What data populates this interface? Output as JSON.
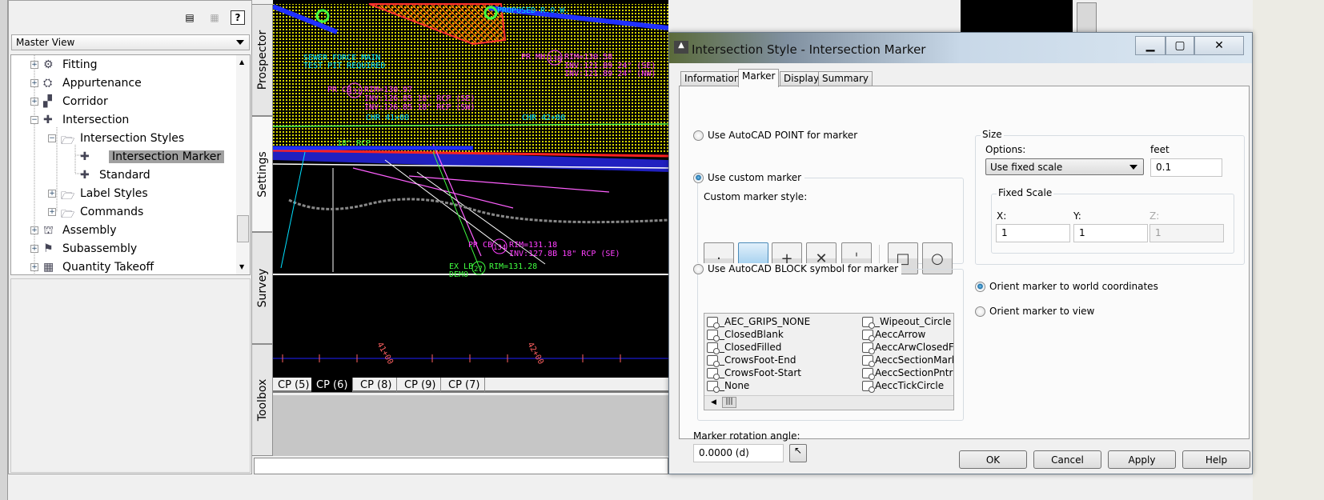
{
  "panel": {
    "toolbar_icons": [
      "item-view-icon",
      "panel-view-icon",
      "help-icon"
    ],
    "help_label": "?",
    "view_select": "Master View",
    "tree": [
      {
        "label": "Fitting",
        "expand": "+"
      },
      {
        "label": "Appurtenance",
        "expand": "+"
      },
      {
        "label": "Corridor",
        "expand": "+"
      },
      {
        "label": "Intersection",
        "expand": "−"
      },
      {
        "label": "Intersection Styles",
        "expand": "−"
      },
      {
        "label": "Intersection Marker",
        "selected": true
      },
      {
        "label": "Standard"
      },
      {
        "label": "Label Styles",
        "expand": "+"
      },
      {
        "label": "Commands",
        "expand": "+"
      },
      {
        "label": "Assembly",
        "expand": "+"
      },
      {
        "label": "Subassembly",
        "expand": "+"
      },
      {
        "label": "Quantity Takeoff",
        "expand": "+"
      }
    ]
  },
  "side_tabs": [
    "Prospector",
    "Settings",
    "Survey",
    "Toolbox"
  ],
  "cad": {
    "labels": [
      "SEWER FORCE MAIN",
      "TEST PIT REQUIRED",
      "PROPOSED R.O.W.",
      "PR MH",
      "138",
      "RIM=130.58",
      "INV:121.89 24\" (SE)",
      "INV:121.89 24\" (NW)",
      "PR CB",
      "131",
      "RIM=130.97",
      "INV:126.85 18\" RCP (SE)",
      "INV:126.85 18\" RCP (SW)",
      "CHR 41+00",
      "CHR 42+00",
      "18\" RCP",
      "PR CB",
      "134",
      "RIM=131.18",
      "INV:127.8B 18\" RCP (SE)",
      "EX LB",
      "27",
      "RIM=131.28",
      "DEMO",
      "41+00",
      "42+00"
    ],
    "layout_tabs": [
      "CP (5)",
      "CP (6)",
      "CP (8)",
      "CP (9)",
      "CP (7)"
    ],
    "active_layout": "CP (6)"
  },
  "dialog": {
    "title": "Intersection Style - Intersection Marker",
    "tabs": [
      "Information",
      "Marker",
      "Display",
      "Summary"
    ],
    "active_tab": "Marker",
    "radio_point": "Use AutoCAD POINT for marker",
    "radio_custom": "Use custom marker",
    "custom_style_label": "Custom marker style:",
    "marker_buttons": [
      "dot",
      "none",
      "plus",
      "x",
      "tick",
      "square",
      "circle"
    ],
    "marker_glyphs": [
      "·",
      "",
      "+",
      "✕",
      "ˈ",
      "□",
      "○"
    ],
    "radio_block": "Use AutoCAD BLOCK symbol for marker",
    "blocks_col1": [
      "_AEC_GRIPS_NONE",
      "_ClosedBlank",
      "_ClosedFilled",
      "_CrowsFoot-End",
      "_CrowsFoot-Start",
      "_None"
    ],
    "blocks_col2": [
      "_Wipeout_Circle",
      "AeccArrow",
      "AeccArwClosedFill",
      "AeccSectionMark",
      "AeccSectionPntr",
      "AeccTickCircle"
    ],
    "rotation_label": "Marker rotation angle:",
    "rotation_value": "0.0000 (d)",
    "size": {
      "group": "Size",
      "options_label": "Options:",
      "options_value": "Use fixed scale",
      "units_label": "feet",
      "units_value": "0.1",
      "fixed_scale": "Fixed Scale",
      "x_label": "X:",
      "x_value": "1",
      "y_label": "Y:",
      "y_value": "1",
      "z_label": "Z:",
      "z_value": "1"
    },
    "orient_world": "Orient marker to world coordinates",
    "orient_view": "Orient marker to view",
    "buttons": {
      "ok": "OK",
      "cancel": "Cancel",
      "apply": "Apply",
      "help": "Help"
    }
  }
}
